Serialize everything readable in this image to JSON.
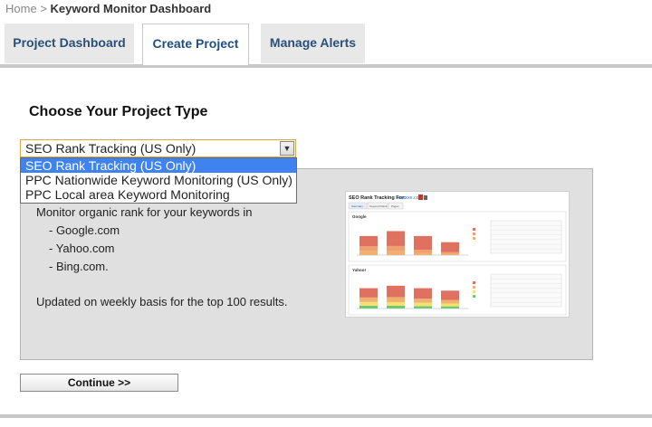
{
  "breadcrumb": {
    "home": "Home",
    "separator": ">",
    "current": "Keyword Monitor Dashboard"
  },
  "tabs": [
    {
      "label": "Project Dashboard",
      "active": false
    },
    {
      "label": "Create Project",
      "active": true
    },
    {
      "label": "Manage Alerts",
      "active": false
    }
  ],
  "main": {
    "title": "Choose Your Project Type",
    "select": {
      "value": "SEO Rank Tracking (US Only)",
      "options": [
        "SEO Rank Tracking (US Only)",
        "PPC Nationwide Keyword Monitoring (US Only)",
        "PPC Local area Keyword Monitoring"
      ]
    },
    "description": {
      "lead": "Monitor organic rank for your keywords in",
      "engines": [
        "- Google.com",
        "- Yahoo.com",
        "- Bing.com."
      ],
      "note": "Updated on weekly basis for the top 100 results."
    },
    "continue_label": "Continue >>"
  },
  "preview": {
    "title": "SEO Rank Tracking For:",
    "domain": "xxxxxx.com",
    "tabs": [
      "Summary",
      "Keyword Rank",
      "Pages"
    ],
    "google_label": "Google",
    "yahoo_label": "Yahoo!",
    "google_bars": [
      {
        "stack": [
          0.22,
          0.24,
          0.54
        ]
      },
      {
        "stack": [
          0.16,
          0.22,
          0.62
        ]
      },
      {
        "stack": [
          0.12,
          0.16,
          0.72
        ]
      },
      {
        "stack": [
          0.1,
          0.14,
          0.76
        ]
      }
    ],
    "yahoo_bars": [
      {
        "stack": [
          0.14,
          0.18,
          0.22,
          0.46
        ]
      },
      {
        "stack": [
          0.12,
          0.16,
          0.22,
          0.5
        ]
      },
      {
        "stack": [
          0.12,
          0.16,
          0.2,
          0.52
        ]
      },
      {
        "stack": [
          0.12,
          0.16,
          0.2,
          0.52
        ]
      }
    ],
    "google_heights": [
      0.62,
      0.78,
      0.62,
      0.42
    ],
    "yahoo_heights": [
      0.66,
      0.74,
      0.66,
      0.58
    ],
    "colors": {
      "red": "#e07060",
      "orange": "#f2b070",
      "yellow": "#f5e070",
      "green": "#70c870"
    }
  }
}
